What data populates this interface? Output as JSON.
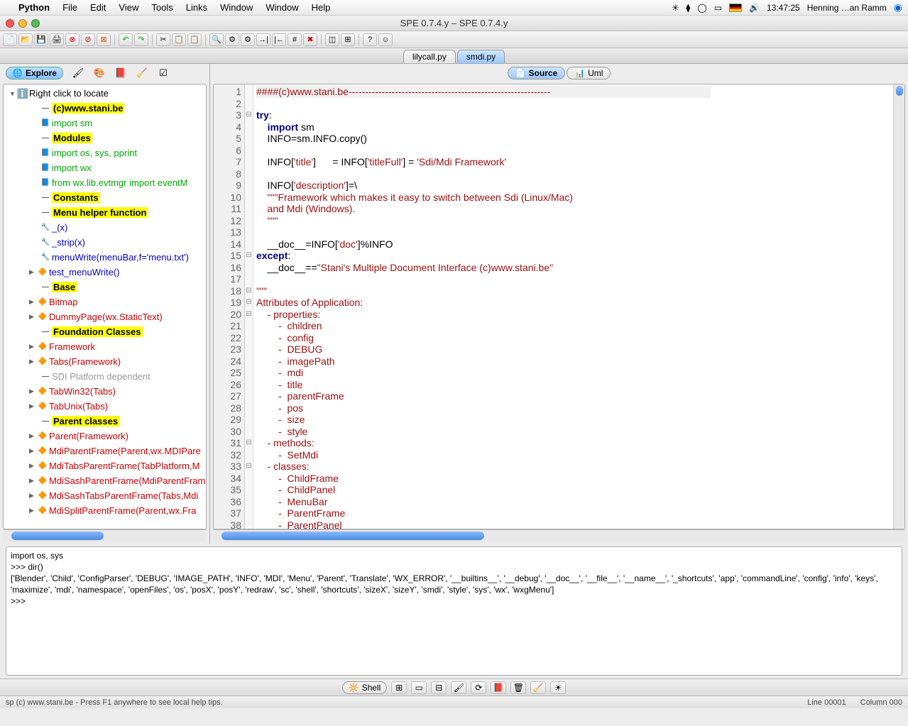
{
  "menubar": {
    "app": "Python",
    "items": [
      "File",
      "Edit",
      "View",
      "Tools",
      "Links",
      "Window",
      "Window",
      "Help"
    ],
    "clock": "13:47:25",
    "user": "Henning …an Ramm"
  },
  "window": {
    "title": "SPE 0.7.4.y – SPE 0.7.4.y"
  },
  "file_tabs": {
    "items": [
      "lilycall.py",
      "smdi.py"
    ],
    "active": 1
  },
  "left": {
    "tab": "Explore",
    "root": "Right click to locate",
    "nodes": [
      {
        "label": "(c)www.stani.be",
        "hl": true,
        "icon": "dash"
      },
      {
        "label": "import sm",
        "cls": "green",
        "icon": "import"
      },
      {
        "label": "Modules",
        "hl": true,
        "icon": "dash"
      },
      {
        "label": "import  os, sys, pprint",
        "cls": "green",
        "icon": "import"
      },
      {
        "label": "import  wx",
        "cls": "green",
        "icon": "import"
      },
      {
        "label": "from    wx.lib.evtmgr import eventM",
        "cls": "green",
        "icon": "import"
      },
      {
        "label": "Constants",
        "hl": true,
        "icon": "dash"
      },
      {
        "label": "Menu helper function",
        "hl": true,
        "icon": "dash"
      },
      {
        "label": "_(x)",
        "cls": "blue",
        "icon": "fn"
      },
      {
        "label": "_strip(x)",
        "cls": "blue",
        "icon": "fn"
      },
      {
        "label": "menuWrite(menuBar,f='menu.txt')",
        "cls": "blue",
        "icon": "fn"
      },
      {
        "label": "test_menuWrite()",
        "cls": "blue",
        "icon": "cls",
        "tri": true
      },
      {
        "label": "Base",
        "hl": true,
        "icon": "dash"
      },
      {
        "label": "Bitmap",
        "cls": "red",
        "icon": "cls",
        "tri": true
      },
      {
        "label": "DummyPage(wx.StaticText)",
        "cls": "red",
        "icon": "cls",
        "tri": true
      },
      {
        "label": "Foundation Classes",
        "hl": true,
        "icon": "dash"
      },
      {
        "label": "Framework",
        "cls": "red",
        "icon": "cls",
        "tri": true
      },
      {
        "label": "Tabs(Framework)",
        "cls": "red",
        "icon": "cls",
        "tri": true
      },
      {
        "label": "SDI Platform dependent",
        "cls": "gray",
        "icon": "dash"
      },
      {
        "label": "TabWin32(Tabs)",
        "cls": "red",
        "icon": "cls",
        "tri": true
      },
      {
        "label": "TabUnix(Tabs)",
        "cls": "red",
        "icon": "cls",
        "tri": true
      },
      {
        "label": "Parent classes",
        "hl": true,
        "icon": "dash"
      },
      {
        "label": "Parent(Framework)",
        "cls": "red",
        "icon": "cls",
        "tri": true
      },
      {
        "label": "MdiParentFrame(Parent,wx.MDIPare",
        "cls": "red",
        "icon": "cls",
        "tri": true
      },
      {
        "label": "MdiTabsParentFrame(TabPlatform,M",
        "cls": "red",
        "icon": "cls",
        "tri": true
      },
      {
        "label": "MdiSashParentFrame(MdiParentFram",
        "cls": "red",
        "icon": "cls",
        "tri": true
      },
      {
        "label": "MdiSashTabsParentFrame(Tabs,Mdi",
        "cls": "red",
        "icon": "cls",
        "tri": true
      },
      {
        "label": "MdiSplitParentFrame(Parent,wx.Fra",
        "cls": "red",
        "icon": "cls",
        "tri": true
      }
    ]
  },
  "right_tabs": {
    "items": [
      "Source",
      "Uml"
    ],
    "active": 0
  },
  "code": {
    "start": 1,
    "lines": [
      {
        "t": "####(c)www.stani.be-------------------------------------------------------------",
        "cls": "c",
        "hl": true
      },
      {
        "t": ""
      },
      {
        "t": "try:",
        "fold": "⊟",
        "parts": [
          [
            "try",
            "k"
          ],
          [
            ":",
            ""
          ]
        ]
      },
      {
        "t": "    import sm",
        "parts": [
          [
            "    ",
            ""
          ],
          [
            "import",
            "k"
          ],
          [
            " sm",
            ""
          ]
        ]
      },
      {
        "t": "    INFO=sm.INFO.copy()"
      },
      {
        "t": ""
      },
      {
        "t": "    INFO['title']      = INFO['titleFull'] = 'Sdi/Mdi Framework'",
        "parts": [
          [
            "    INFO[",
            ""
          ],
          [
            "'title'",
            "s"
          ],
          [
            "]      = INFO[",
            ""
          ],
          [
            "'titleFull'",
            "s"
          ],
          [
            "] = ",
            ""
          ],
          [
            "'Sdi/Mdi Framework'",
            "s"
          ]
        ]
      },
      {
        "t": ""
      },
      {
        "t": "    INFO['description']=\\",
        "parts": [
          [
            "    INFO[",
            ""
          ],
          [
            "'description'",
            "s"
          ],
          [
            "]=\\",
            ""
          ]
        ]
      },
      {
        "t": "    \"\"\"Framework which makes it easy to switch between Sdi (Linux/Mac)",
        "cls": "r"
      },
      {
        "t": "    and Mdi (Windows).",
        "cls": "r"
      },
      {
        "t": "    \"\"\"",
        "cls": "r"
      },
      {
        "t": ""
      },
      {
        "t": "    __doc__=INFO['doc']%INFO",
        "parts": [
          [
            "    __doc__=INFO[",
            ""
          ],
          [
            "'doc'",
            "s"
          ],
          [
            "]%INFO",
            ""
          ]
        ]
      },
      {
        "t": "except:",
        "fold": "⊟",
        "parts": [
          [
            "except",
            "k"
          ],
          [
            ":",
            ""
          ]
        ]
      },
      {
        "t": "    __doc__==\"Stani's Multiple Document Interface (c)www.stani.be\"",
        "parts": [
          [
            "    __doc__==",
            ""
          ],
          [
            "\"Stani's Multiple Document Interface (c)www.stani.be\"",
            "s"
          ]
        ]
      },
      {
        "t": ""
      },
      {
        "t": "\"\"\"",
        "cls": "r",
        "fold": "⊟"
      },
      {
        "t": "Attributes of Application:",
        "cls": "r",
        "fold": "⊟"
      },
      {
        "t": "    - properties:",
        "cls": "r",
        "fold": "⊟"
      },
      {
        "t": "        -  children",
        "cls": "r"
      },
      {
        "t": "        -  config",
        "cls": "r"
      },
      {
        "t": "        -  DEBUG",
        "cls": "r"
      },
      {
        "t": "        -  imagePath",
        "cls": "r"
      },
      {
        "t": "        -  mdi",
        "cls": "r"
      },
      {
        "t": "        -  title",
        "cls": "r"
      },
      {
        "t": "        -  parentFrame",
        "cls": "r"
      },
      {
        "t": "        -  pos",
        "cls": "r"
      },
      {
        "t": "        -  size",
        "cls": "r"
      },
      {
        "t": "        -  style",
        "cls": "r"
      },
      {
        "t": "    - methods:",
        "cls": "r",
        "fold": "⊟"
      },
      {
        "t": "        -  SetMdi",
        "cls": "r"
      },
      {
        "t": "    - classes:",
        "cls": "r",
        "fold": "⊟"
      },
      {
        "t": "        -  ChildFrame",
        "cls": "r"
      },
      {
        "t": "        -  ChildPanel",
        "cls": "r"
      },
      {
        "t": "        -  MenuBar",
        "cls": "r"
      },
      {
        "t": "        -  ParentFrame",
        "cls": "r"
      },
      {
        "t": "        -  ParentPanel",
        "cls": "r"
      }
    ]
  },
  "console": {
    "lines": [
      "import os, sys",
      ">>> dir()",
      "['Blender', 'Child', 'ConfigParser', 'DEBUG', 'IMAGE_PATH', 'INFO', 'MDI', 'Menu', 'Parent', 'Translate', 'WX_ERROR', '__builtins__', '__debug', '__doc__', '__file__', '__name__', '_shortcuts', 'app', 'commandLine', 'config', 'info', 'keys', 'maximize', 'mdi', 'namespace', 'openFiles', 'os', 'posX', 'posY', 'redraw', 'sc', 'shell', 'shortcuts', 'sizeX', 'sizeY', 'smdi', 'style', 'sys', 'wx', 'wxgMenu']",
      ">>> "
    ]
  },
  "bottom": {
    "tab": "Shell"
  },
  "status": {
    "left": "sp   (c) www.stani.be - Press F1 anywhere to see local help tips.",
    "line": "Line 00001",
    "col": "Column 000"
  }
}
